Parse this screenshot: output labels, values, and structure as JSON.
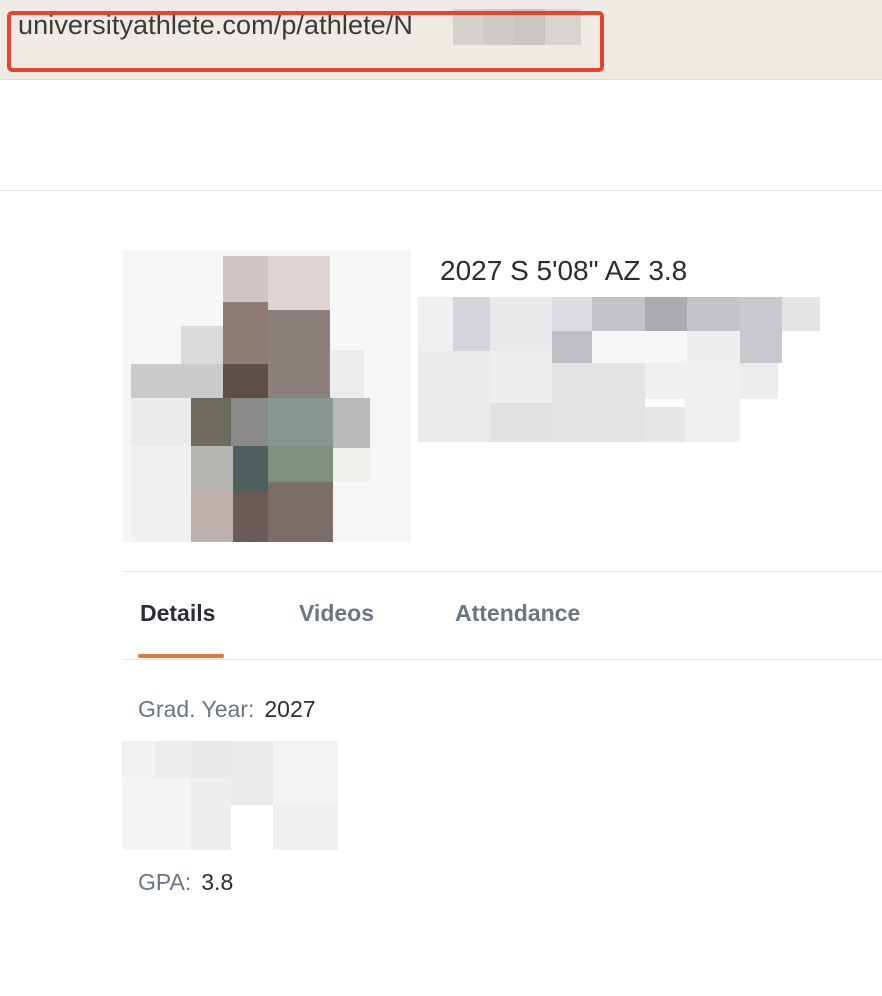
{
  "browser": {
    "url": "universityathlete.com/p/athlete/N"
  },
  "profile": {
    "headline": "2027 S 5'08\" AZ 3.8"
  },
  "tabs": [
    {
      "label": "Details",
      "active": true
    },
    {
      "label": "Videos",
      "active": false
    },
    {
      "label": "Attendance",
      "active": false
    }
  ],
  "details": {
    "grad_year_label": "Grad. Year:",
    "grad_year_value": "2027",
    "gpa_label": "GPA:",
    "gpa_value": "3.8"
  },
  "colors": {
    "accent": "#e07a3a",
    "highlight_box": "#e3452e",
    "muted_text": "#6b7682"
  }
}
